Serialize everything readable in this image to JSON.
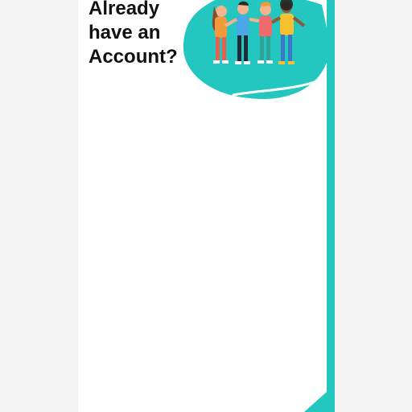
{
  "welcome": {
    "heading_lines": [
      "Already",
      "have an",
      "Account?"
    ]
  },
  "colors": {
    "accent": "#23c7bf",
    "background": "#f4f4f4",
    "card": "#ffffff",
    "text": "#111111"
  },
  "illustration": {
    "icon": "friends-group-illustration"
  }
}
